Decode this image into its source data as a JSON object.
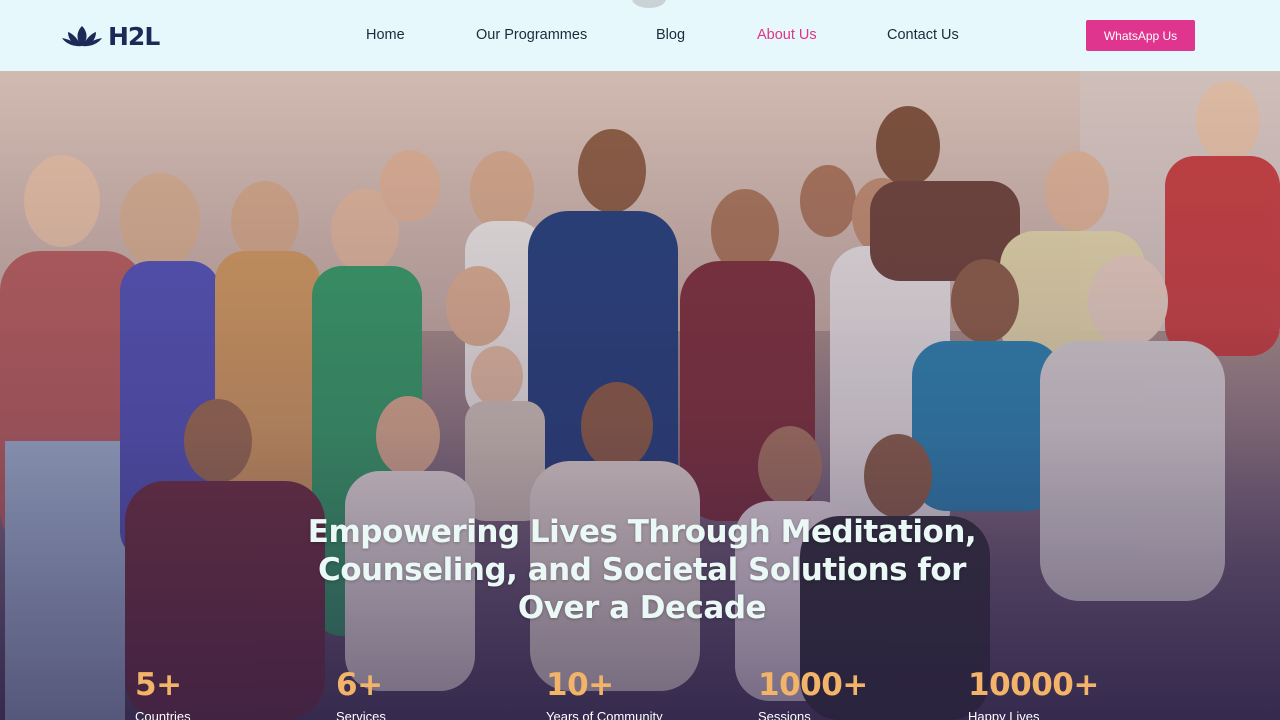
{
  "brand": {
    "name": "H2L"
  },
  "nav": {
    "items": [
      {
        "label": "Home",
        "active": false
      },
      {
        "label": "Our Programmes",
        "active": false
      },
      {
        "label": "Blog",
        "active": false
      },
      {
        "label": "About Us",
        "active": true
      },
      {
        "label": "Contact Us",
        "active": false
      }
    ],
    "cta_label": "WhatsApp Us"
  },
  "colors": {
    "header_bg": "#e6f8fb",
    "accent_pink": "#e0358f",
    "stat_orange": "#f3b46a",
    "brand_navy": "#1b2a57"
  },
  "hero": {
    "title": "Empowering Lives Through Meditation, Counseling, and Societal Solutions for Over a Decade",
    "stats": [
      {
        "value": "5+",
        "label": "Countries"
      },
      {
        "value": "6+",
        "label": "Services"
      },
      {
        "value": "10+",
        "label": "Years of Community"
      },
      {
        "value": "1000+",
        "label": "Sessions"
      },
      {
        "value": "10000+",
        "label": "Happy Lives"
      }
    ]
  }
}
